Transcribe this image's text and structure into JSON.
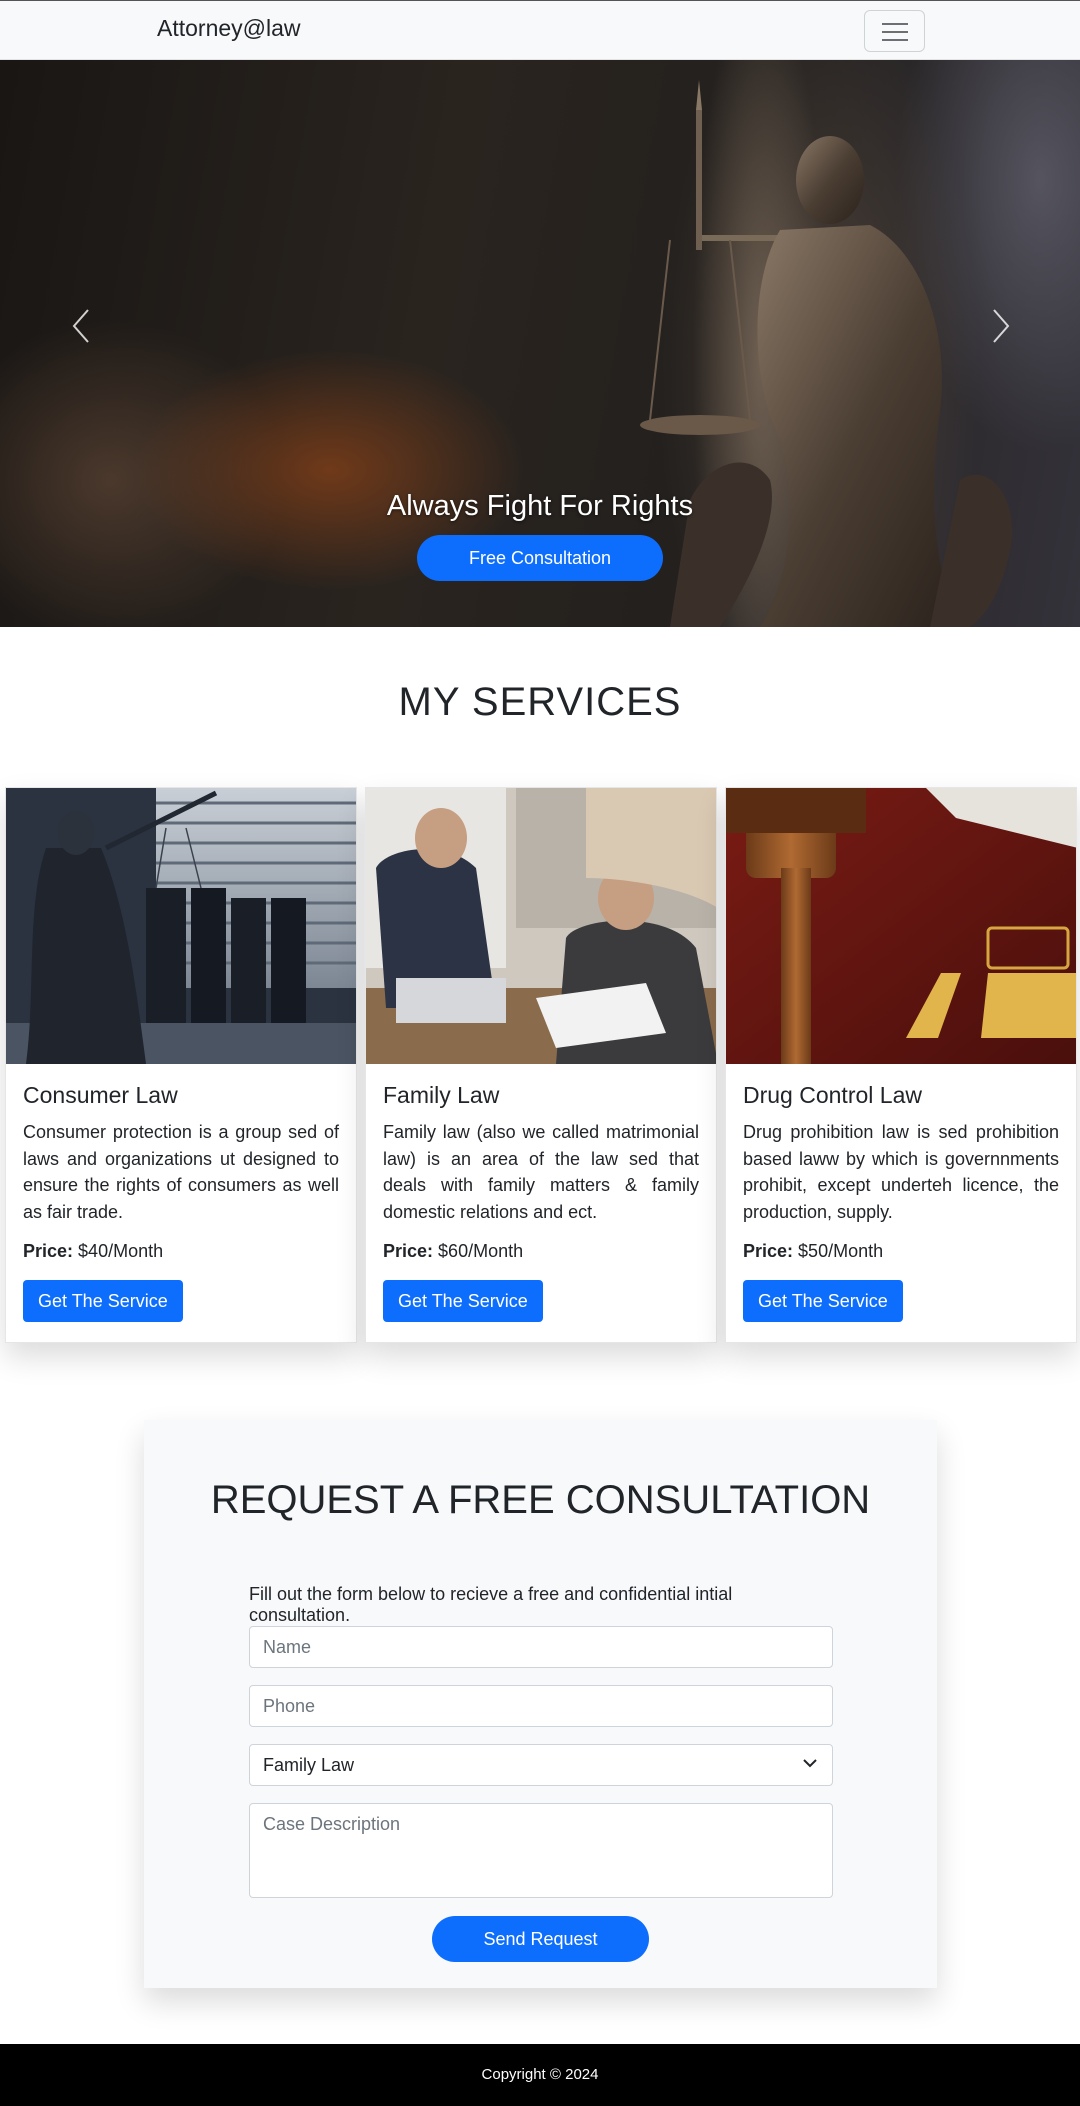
{
  "navbar": {
    "brand": "Attorney@law"
  },
  "hero": {
    "title": "Always Fight For Rights",
    "button_label": "Free Consultation",
    "prev_icon": "chevron-left-icon",
    "next_icon": "chevron-right-icon",
    "slide_count": 3,
    "active_slide": 3
  },
  "services": {
    "title": "MY SERVICES",
    "cards": [
      {
        "title": "Consumer Law",
        "text": "Consumer protection is a group sed of laws and organizations ut designed to ensure the rights of consumers as well as fair trade.",
        "price_label": "Price:",
        "price": "$40/Month",
        "button_label": "Get The Service"
      },
      {
        "title": "Family Law",
        "text": "Family law (also we called matrimonial law) is an area of the law sed that deals with family matters & family domestic relations and ect.",
        "price_label": "Price:",
        "price": "$60/Month",
        "button_label": "Get The Service"
      },
      {
        "title": "Drug Control Law",
        "text": "Drug prohibition law is sed prohibition based laww by which is governnments prohibit, except underteh licence, the production, supply.",
        "price_label": "Price:",
        "price": "$50/Month",
        "button_label": "Get The Service"
      }
    ]
  },
  "consultation": {
    "title": "REQUEST A FREE CONSULTATION",
    "intro": "Fill out the form below to recieve a free and confidential intial consultation.",
    "name_placeholder": "Name",
    "phone_placeholder": "Phone",
    "case_type_value": "Family Law",
    "description_placeholder": "Case Description",
    "submit_label": "Send Request"
  },
  "footer": {
    "copyright": "Copyright © 2024"
  },
  "colors": {
    "primary": "#0d6efd",
    "navbar_bg": "#f8f9fa",
    "footer_bg": "#000000"
  }
}
